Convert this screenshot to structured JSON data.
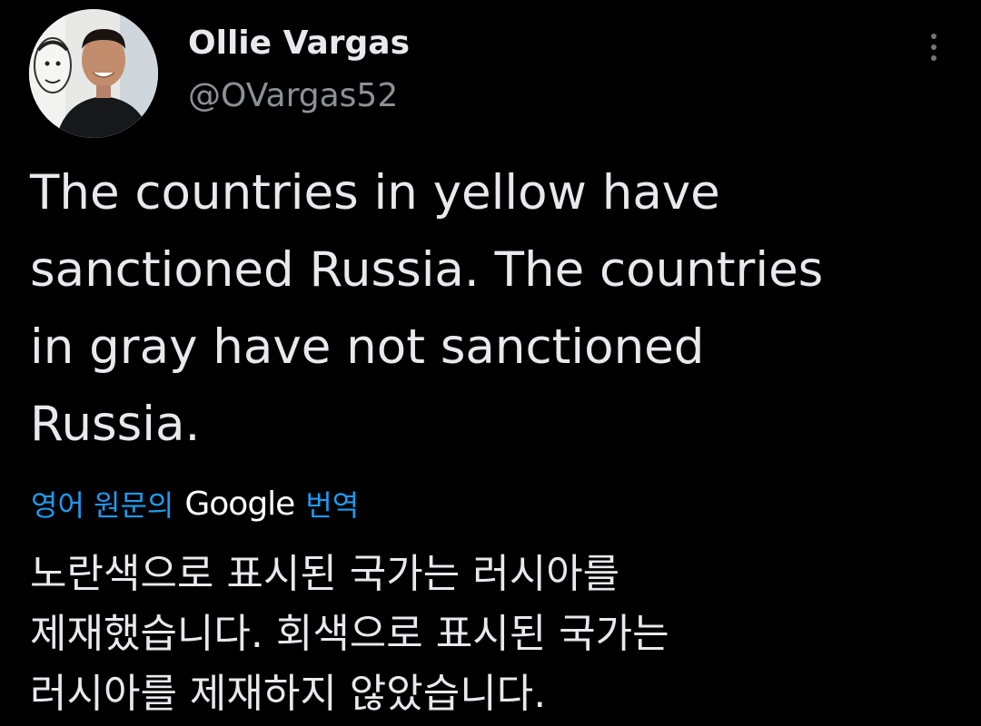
{
  "tweet": {
    "author": {
      "display_name": "Ollie Vargas",
      "handle": "@OVargas52",
      "avatar_icon": "profile-photo"
    },
    "more_icon": "more-vertical-icon",
    "text": "The countries in yellow have\nsanctioned Russia. The countries\nin gray have not sanctioned\nRussia.",
    "translation": {
      "prefix_label": "영어 원문의",
      "provider": "Google",
      "suffix_label": "번역",
      "text": "노란색으로 표시된 국가는 러시아를\n제재했습니다. 회색으로 표시된 국가는\n러시아를 제재하지 않았습니다."
    }
  },
  "colors": {
    "background": "#000000",
    "primary_text": "#e7e9ea",
    "secondary_text": "#8b9197",
    "link": "#1d9bf0"
  }
}
